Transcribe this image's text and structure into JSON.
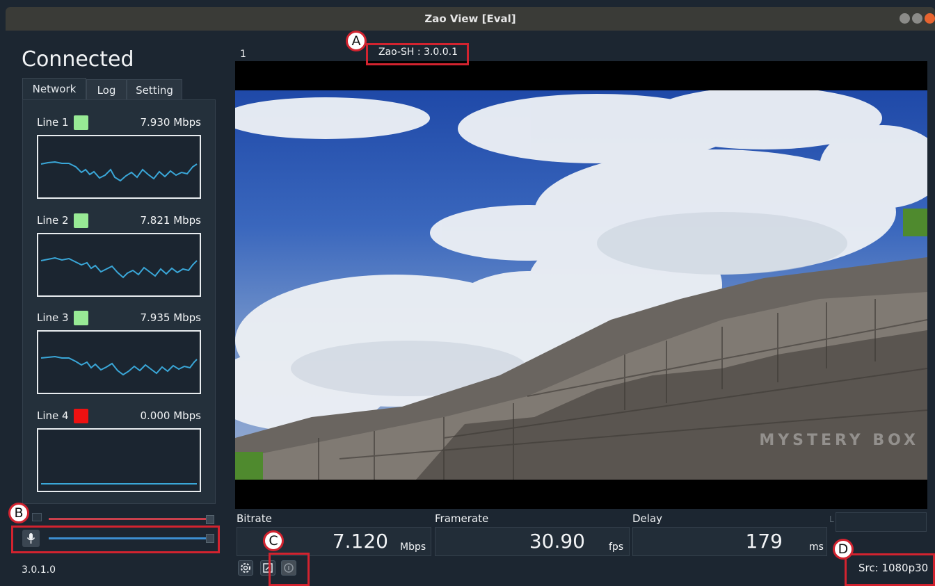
{
  "window": {
    "title": "Zao View [Eval]"
  },
  "status": "Connected",
  "tabs": [
    {
      "label": "Network",
      "active": true
    },
    {
      "label": "Log",
      "active": false
    },
    {
      "label": "Setting",
      "active": false
    }
  ],
  "lines": [
    {
      "label": "Line 1",
      "rate": "7.930 Mbps",
      "status_color": "#98ea95"
    },
    {
      "label": "Line 2",
      "rate": "7.821 Mbps",
      "status_color": "#98ea95"
    },
    {
      "label": "Line 3",
      "rate": "7.935 Mbps",
      "status_color": "#98ea95"
    },
    {
      "label": "Line 4",
      "rate": "0.000 Mbps",
      "status_color": "#ee1111"
    }
  ],
  "audio": {
    "speaker_icon": "speaker-icon",
    "mic_icon": "microphone-icon",
    "output_color": "#c9404c",
    "input_color": "#3d8fd2"
  },
  "version": "3.0.1.0",
  "video": {
    "channel_number": "1",
    "channel_name": "Zao-SH : 3.0.0.1",
    "watermark": "MYSTERY BOX"
  },
  "metrics": {
    "bitrate": {
      "label": "Bitrate",
      "value": "7.120",
      "unit": "Mbps"
    },
    "framerate": {
      "label": "Framerate",
      "value": "30.90",
      "unit": "fps"
    },
    "delay": {
      "label": "Delay",
      "value": "179",
      "unit": "ms"
    }
  },
  "l_label": "L",
  "source": "Src: 1080p30",
  "bottom_icons": [
    "settings-gear-icon",
    "fullscreen-icon",
    "info-icon"
  ],
  "annotations": [
    "A",
    "B",
    "C",
    "D"
  ],
  "colors": {
    "annotation": "#d2232f",
    "graph_line": "#3aa7d8",
    "background": "#1c2631"
  }
}
